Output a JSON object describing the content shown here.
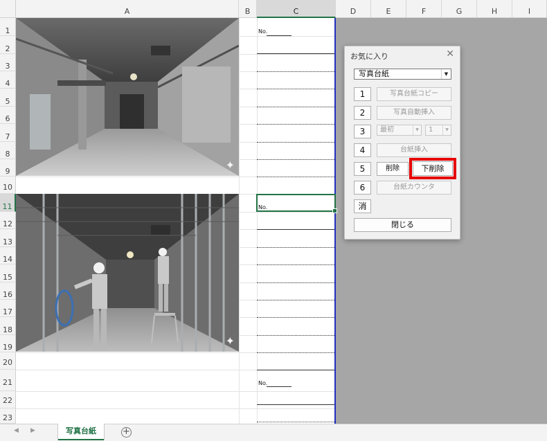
{
  "sheet": {
    "columns": [
      "A",
      "B",
      "C",
      "D",
      "E",
      "F",
      "G",
      "H",
      "I"
    ],
    "rows": [
      "1",
      "2",
      "3",
      "4",
      "5",
      "6",
      "7",
      "8",
      "9",
      "10",
      "11",
      "12",
      "13",
      "14",
      "15",
      "16",
      "17",
      "18",
      "19",
      "20",
      "21",
      "22",
      "23"
    ],
    "selected_column": "C",
    "selected_row": "11",
    "no_label": "No.",
    "photos": [
      {
        "name": "empty-concrete-interior",
        "sparkle": "✦"
      },
      {
        "name": "workers-installing-wiring",
        "sparkle": "✦"
      }
    ]
  },
  "tabs": {
    "nav_prev": "◀",
    "nav_next": "▶",
    "active_sheet": "写真台紙",
    "add_icon": "+"
  },
  "dialog": {
    "title": "お気に入り",
    "close": "✕",
    "dropdown_value": "写真台紙",
    "dropdown_arrow": "▼",
    "row1": {
      "num": "1",
      "label": "写真台紙コピー"
    },
    "row2": {
      "num": "2",
      "label": "写真自動挿入"
    },
    "row3": {
      "num": "3",
      "position": "最初",
      "count": "1",
      "arrow": "▼"
    },
    "row4": {
      "num": "4",
      "label": "台紙挿入"
    },
    "row5": {
      "num": "5",
      "delete": "削除",
      "delete_below": "下削除"
    },
    "row6": {
      "num": "6",
      "label": "台紙カウンタ"
    },
    "clear": "消",
    "close_button": "閉じる",
    "highlight_color": "#e60000"
  }
}
